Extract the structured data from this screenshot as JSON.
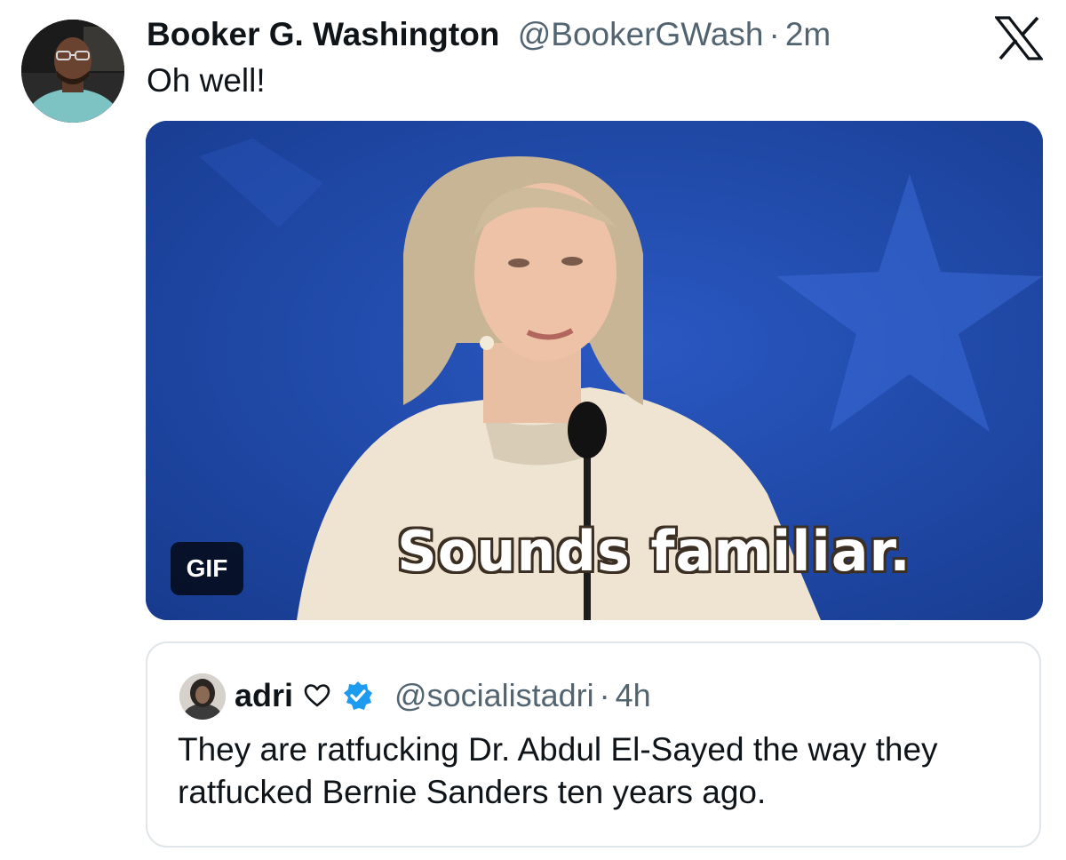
{
  "tweet": {
    "author_name": "Booker G. Washington",
    "author_handle": "@BookerGWash",
    "separator": "·",
    "time": "2m",
    "text": "Oh well!",
    "media": {
      "badge": "GIF",
      "caption": "Sounds familiar."
    }
  },
  "quoted": {
    "author_name": "adri",
    "author_handle": "@socialistadri",
    "separator": "·",
    "time": "4h",
    "text": "They are ratfucking Dr. Abdul El-Sayed the way they ratfucked Bernie Sanders ten years ago."
  },
  "icons": {
    "platform": "x-logo-icon",
    "heart": "heart-outline-icon",
    "verified": "verified-badge-icon"
  },
  "colors": {
    "text_primary": "#0f1419",
    "text_secondary": "#536471",
    "verified_blue": "#1d9bf0",
    "border": "#e1e6ea"
  }
}
